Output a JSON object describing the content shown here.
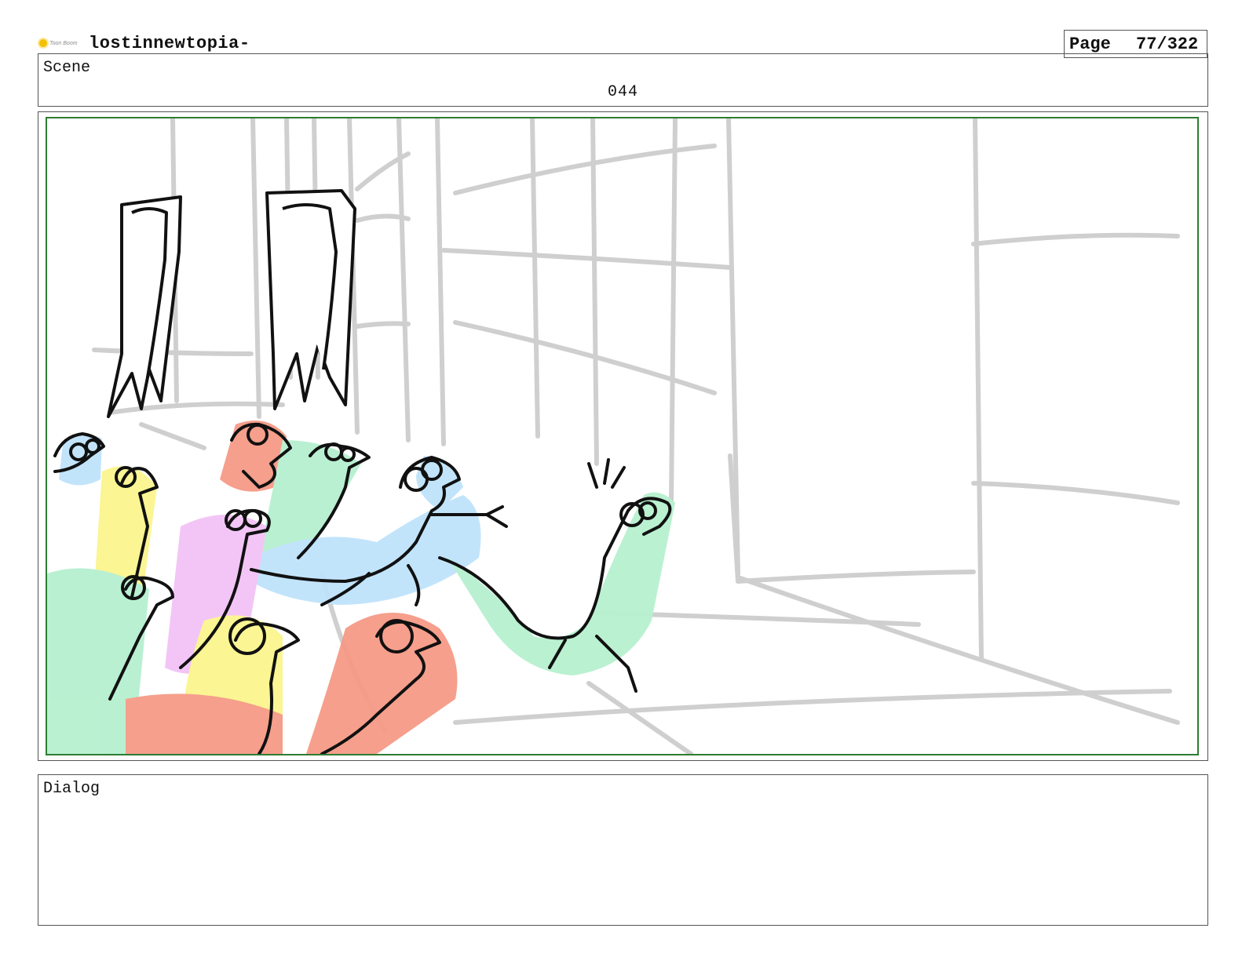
{
  "header": {
    "logo_text": "Toon Boom",
    "project_title": "lostinnewtopia-",
    "page_label": "Page",
    "page_number": "77/322"
  },
  "scene": {
    "label": "Scene",
    "number": "044"
  },
  "panel": {
    "illustration": "storyboard-panel"
  },
  "dialog": {
    "label": "Dialog",
    "text": ""
  },
  "colors": {
    "frame_border": "#2e7d32",
    "sketch_lines": "#cfcfcf",
    "ink": "#111111",
    "creature_green": "#b6f0cf",
    "creature_blue": "#bfe3fb",
    "creature_yellow": "#fbf58e",
    "creature_pink": "#f3c2f6",
    "creature_red": "#f59a86"
  }
}
